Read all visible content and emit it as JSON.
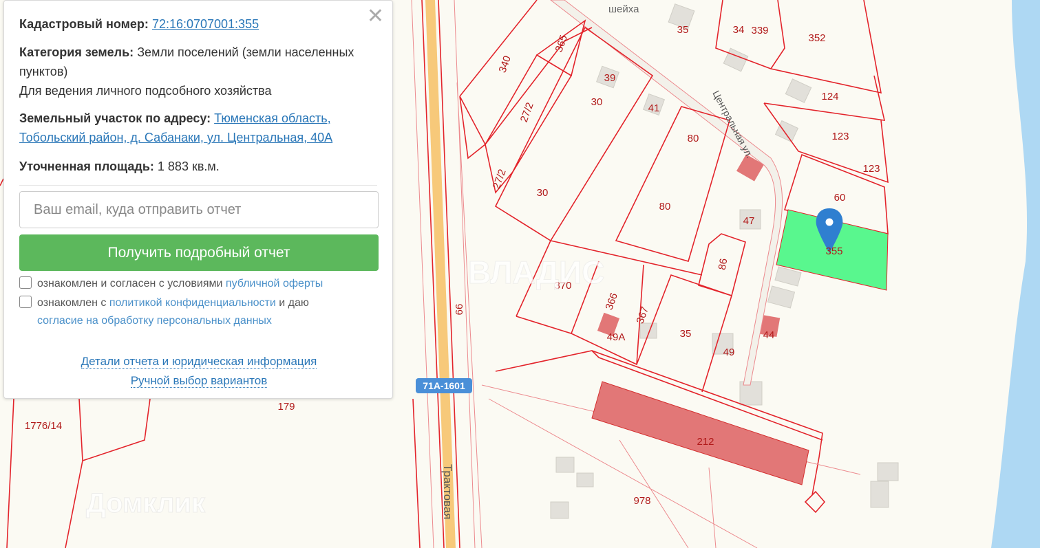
{
  "popup": {
    "cadastral_label": "Кадастровый номер:",
    "cadastral_number": "72:16:0707001:355",
    "category_label": "Категория земель:",
    "category_value": "Земли поселений (земли населенных пунктов)",
    "usage": "Для ведения личного подсобного хозяйства",
    "address_label": "Земельный участок по адресу:",
    "address_value": "Тюменская область, Тобольский район, д. Сабанаки, ул. Центральная, 40А",
    "area_label": "Уточненная площадь:",
    "area_value": "1 883 кв.м.",
    "email_placeholder": "Ваш email, куда отправить отчет",
    "email_value": "",
    "submit_label": "Получить подробный отчет",
    "offer_text": "ознакомлен и согласен с условиями",
    "offer_link": "публичной оферты",
    "offer_checked": false,
    "privacy_text1": "ознакомлен с",
    "privacy_link": "политикой конфиденциальности",
    "privacy_text2": "и даю",
    "consent_link": "согласие на обработку персональных данных",
    "privacy_checked": false,
    "details_link": "Детали отчета и юридическая информация",
    "manual_link": "Ручной выбор вариантов",
    "close_icon": "close-icon",
    "button_color": "#5cb85c",
    "link_color": "#2a77b8"
  },
  "map": {
    "parcel_labels": [
      "365",
      "340",
      "27/2",
      "27/2",
      "30",
      "30",
      "39",
      "41",
      "35",
      "34",
      "339",
      "352",
      "124",
      "123",
      "123",
      "80",
      "80",
      "60",
      "47",
      "355",
      "86",
      "370",
      "366",
      "367",
      "35",
      "49",
      "44",
      "49А",
      "212",
      "978",
      "179",
      "1776/14",
      "66"
    ],
    "street_central": "Центральная ул.",
    "street_traktovaya": "Трактовая",
    "street_top": "шейха",
    "road_badge": "71А-1601",
    "watermark_vladis": "ВЛАДИС",
    "watermark_domclick": "Домклик",
    "selected_parcel_color": "#59f78e",
    "boundary_color": "#e3242b",
    "marker_icon": "map-pin-icon",
    "water_color": "#aed8f3"
  }
}
